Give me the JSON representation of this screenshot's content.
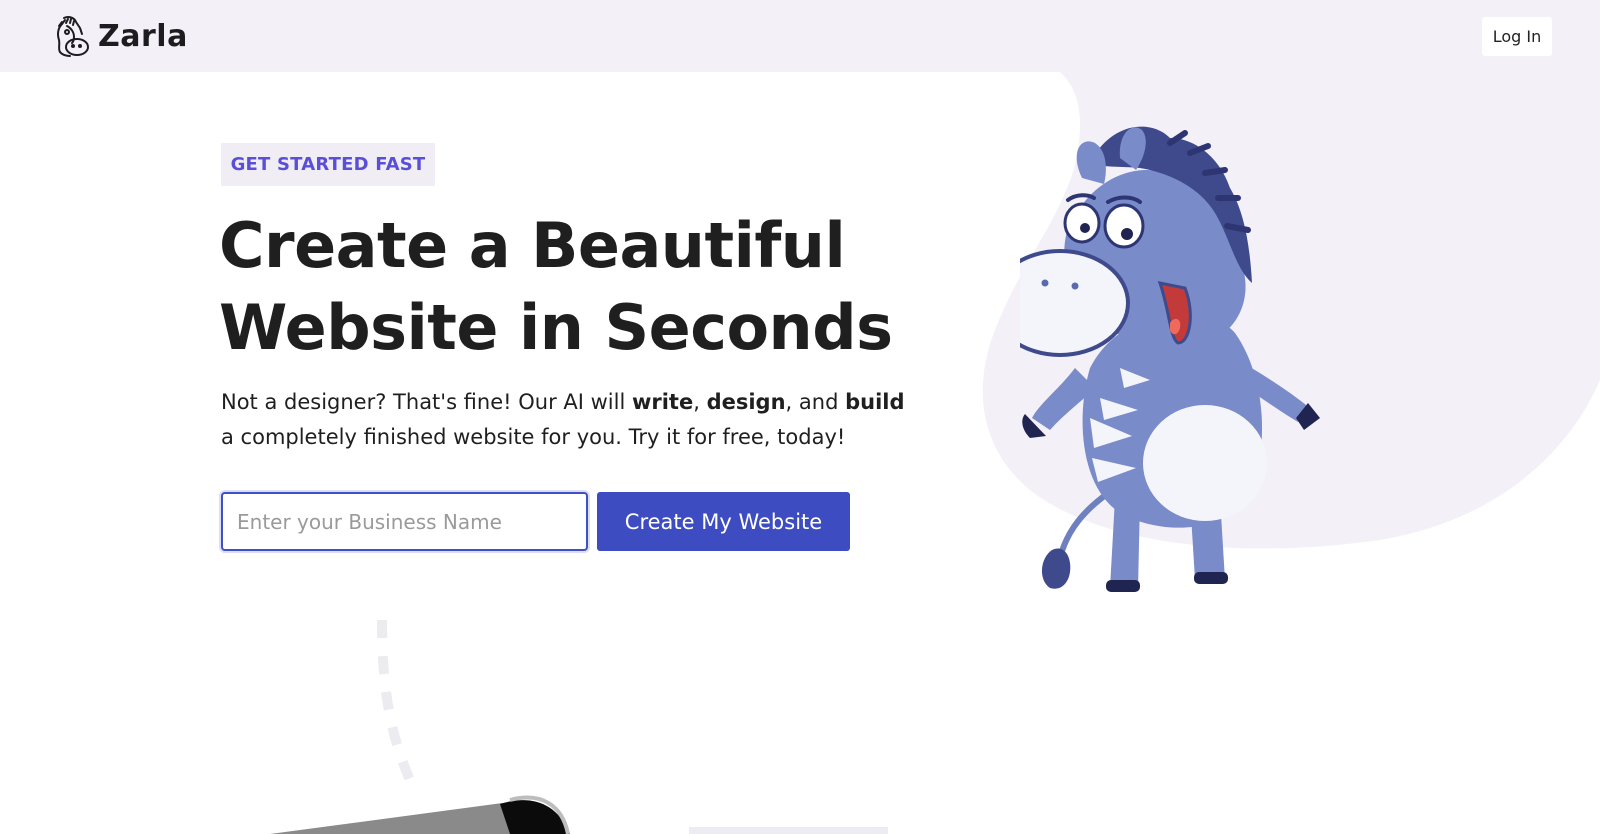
{
  "header": {
    "logo_text": "Zarla",
    "login_label": "Log In"
  },
  "hero": {
    "eyebrow": "GET STARTED FAST",
    "headline_line1": "Create a Beautiful",
    "headline_line2": "Website in Seconds",
    "sub_part1": "Not a designer? That's fine! Our AI will ",
    "sub_bold1": "write",
    "sub_part2": ", ",
    "sub_bold2": "design",
    "sub_part3": ", and ",
    "sub_bold3": "build",
    "sub_part4": " a completely finished website for you. Try it for free, today!"
  },
  "form": {
    "input_placeholder": "Enter your Business Name",
    "input_value": "",
    "submit_label": "Create My Website"
  },
  "colors": {
    "accent": "#3d4cc0",
    "eyebrow_text": "#5a4fd6",
    "eyebrow_bg": "#f0edf5",
    "blob_bg": "#f3f0f7",
    "zebra_body": "#7a8bc9",
    "zebra_dark": "#3f4a8c"
  },
  "icons": {
    "logo": "zebra-head-logo-icon",
    "mascot": "zebra-mascot-illustration"
  }
}
